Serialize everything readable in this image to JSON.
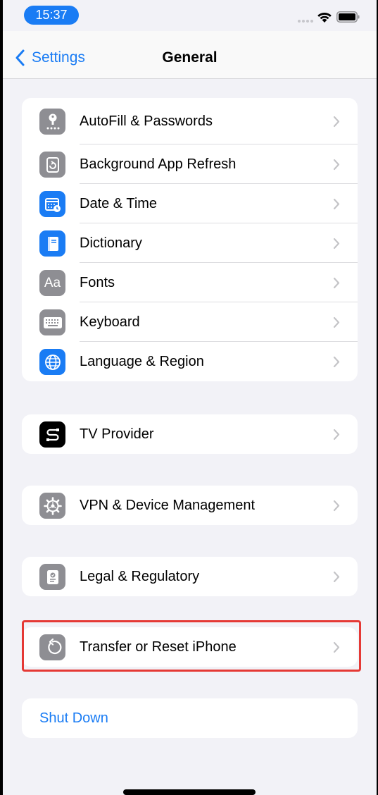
{
  "status_bar": {
    "time": "15:37"
  },
  "nav": {
    "back_label": "Settings",
    "title": "General"
  },
  "groups": [
    {
      "rows": [
        {
          "label": "AutoFill & Passwords",
          "icon": "key-icon",
          "color": "#8e8e93"
        },
        {
          "label": "Background App Refresh",
          "icon": "refresh-icon",
          "color": "#8e8e93"
        },
        {
          "label": "Date & Time",
          "icon": "calendar-clock-icon",
          "color": "#1a7cf4"
        },
        {
          "label": "Dictionary",
          "icon": "book-icon",
          "color": "#1a7cf4"
        },
        {
          "label": "Fonts",
          "icon": "fonts-icon",
          "icon_text": "Aa",
          "color": "#8e8e93"
        },
        {
          "label": "Keyboard",
          "icon": "keyboard-icon",
          "color": "#8e8e93"
        },
        {
          "label": "Language & Region",
          "icon": "globe-icon",
          "color": "#1a7cf4"
        }
      ]
    },
    {
      "rows": [
        {
          "label": "TV Provider",
          "icon": "tv-provider-icon",
          "color": "#000000"
        }
      ]
    },
    {
      "rows": [
        {
          "label": "VPN & Device Management",
          "icon": "gear-icon",
          "color": "#8e8e93"
        }
      ]
    },
    {
      "rows": [
        {
          "label": "Legal & Regulatory",
          "icon": "certificate-icon",
          "color": "#8e8e93"
        }
      ]
    },
    {
      "rows": [
        {
          "label": "Transfer or Reset iPhone",
          "icon": "reset-icon",
          "color": "#8e8e93"
        }
      ]
    }
  ],
  "shutdown": {
    "label": "Shut Down",
    "color": "#1a7cf4"
  },
  "highlight": {
    "target": "Transfer or Reset iPhone",
    "color": "#e53935"
  }
}
